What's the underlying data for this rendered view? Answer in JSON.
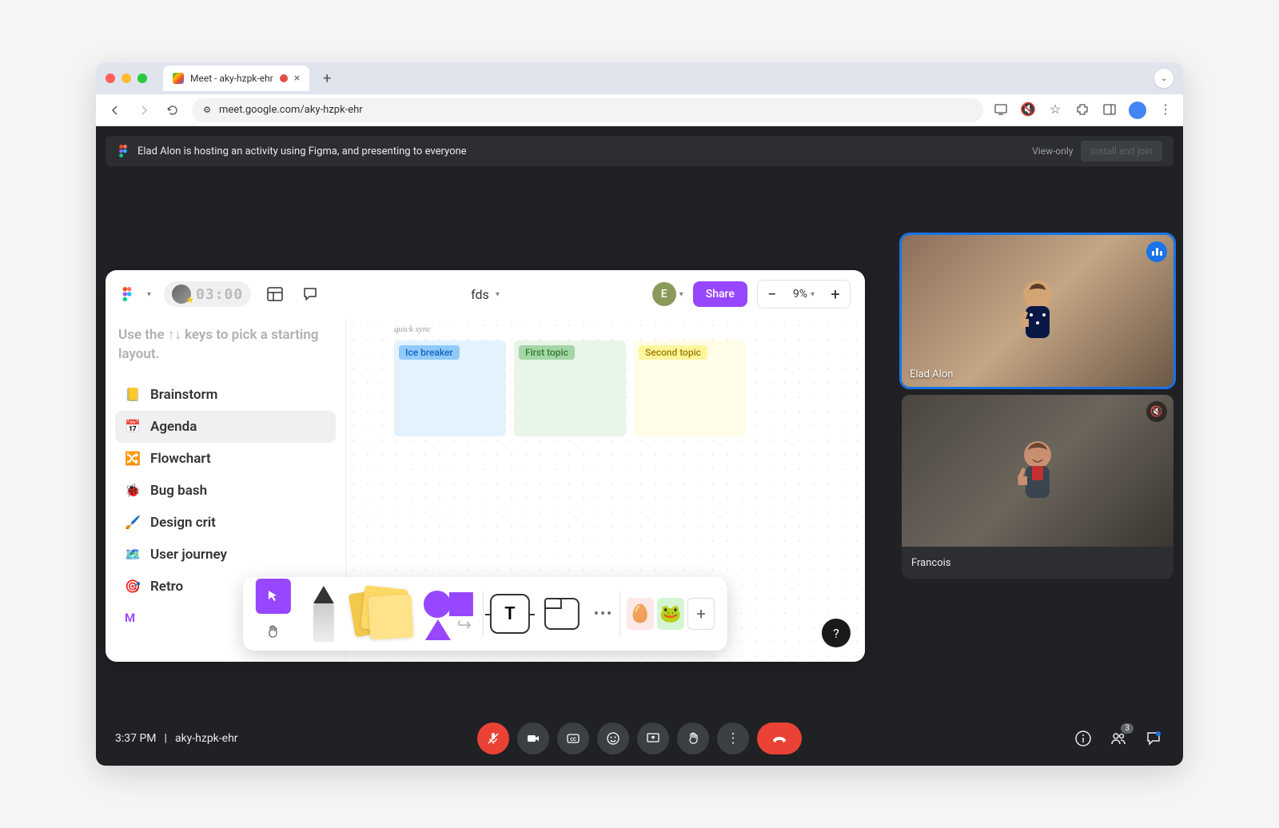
{
  "browser": {
    "tab_title": "Meet - aky-hzpk-ehr",
    "url": "meet.google.com/aky-hzpk-ehr"
  },
  "banner": {
    "text": "Elad Alon is hosting an activity using Figma, and presenting to everyone",
    "view_only": "View-only",
    "install_join": "Install and join"
  },
  "figma": {
    "timer": "03:00",
    "file_name": "fds",
    "avatar_initial": "E",
    "share": "Share",
    "zoom": "9%",
    "helper_text": "Use the ↑↓ keys to pick a starting layout.",
    "templates": [
      {
        "icon": "📒",
        "label": "Brainstorm"
      },
      {
        "icon": "📅",
        "label": "Agenda"
      },
      {
        "icon": "🔀",
        "label": "Flowchart"
      },
      {
        "icon": "🐞",
        "label": "Bug bash"
      },
      {
        "icon": "🖌️",
        "label": "Design crit"
      },
      {
        "icon": "🗺️",
        "label": "User journey"
      },
      {
        "icon": "🎯",
        "label": "Retro"
      }
    ],
    "more_link": "M",
    "canvas": {
      "script_label": "quick sync",
      "notes": [
        "Ice breaker",
        "First topic",
        "Second topic"
      ]
    },
    "help": "?"
  },
  "participants": [
    {
      "name": "Elad Alon",
      "speaking": true,
      "muted": false
    },
    {
      "name": "Francois",
      "speaking": false,
      "muted": true
    }
  ],
  "meet_bar": {
    "time": "3:37 PM",
    "code": "aky-hzpk-ehr",
    "people_count": "3"
  }
}
